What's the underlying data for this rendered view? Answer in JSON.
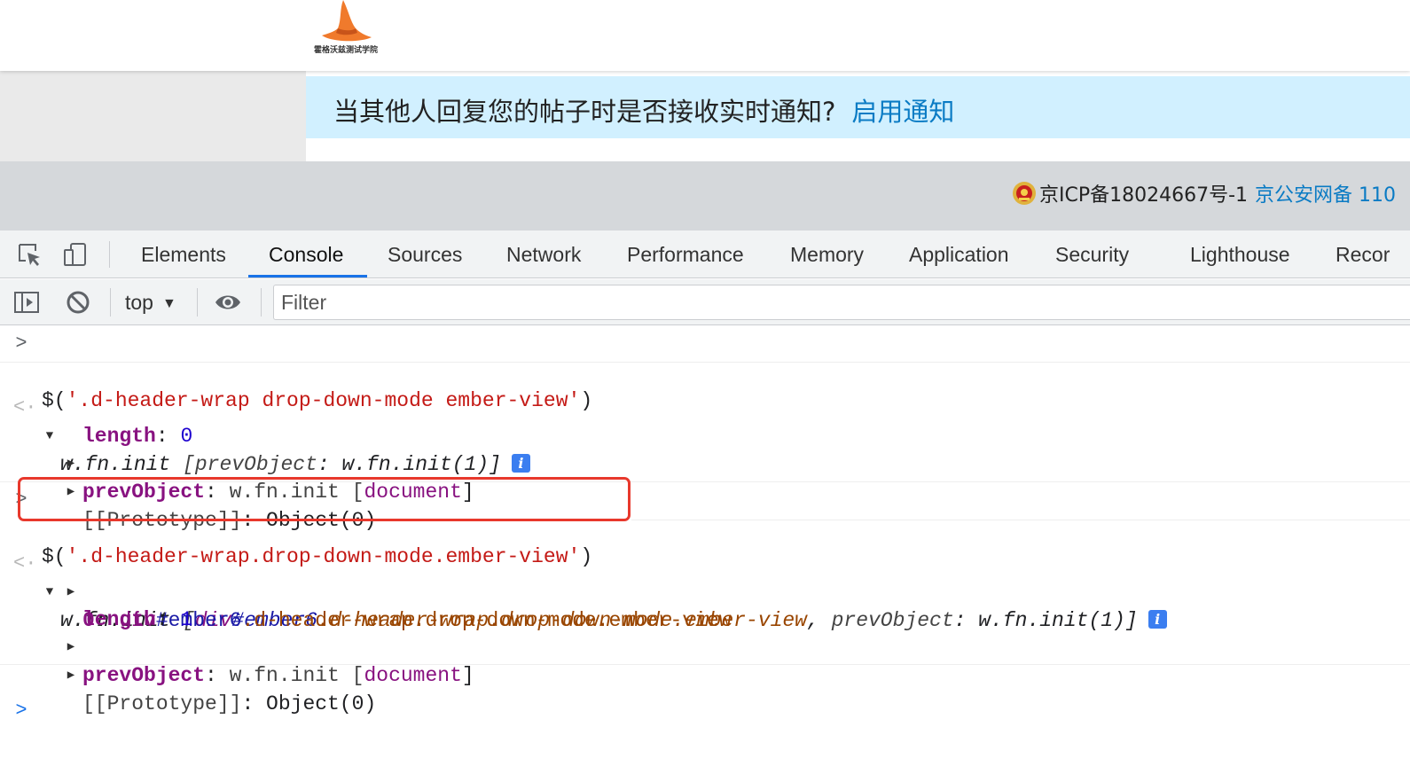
{
  "site": {
    "logo_text": "霍格沃兹测试学院",
    "notify_text": "当其他人回复您的帖子时是否接收实时通知?",
    "notify_link": "启用通知",
    "icp_text": "京ICP备18024667号-1",
    "police_link": "京公安网备 110"
  },
  "devtools": {
    "tabs": [
      {
        "label": "Elements"
      },
      {
        "label": "Console"
      },
      {
        "label": "Sources"
      },
      {
        "label": "Network"
      },
      {
        "label": "Performance"
      },
      {
        "label": "Memory"
      },
      {
        "label": "Application"
      },
      {
        "label": "Security"
      },
      {
        "label": "Lighthouse"
      },
      {
        "label": "Recor"
      }
    ],
    "active_tab": "Console",
    "accent_color": "#1a73e8",
    "toolbar": {
      "context": "top",
      "filter_placeholder": "Filter"
    },
    "console": {
      "cmd1": {
        "prefix": "$(",
        "arg": "'.d-header-wrap drop-down-mode ember-view'",
        "suffix": ")"
      },
      "res1": {
        "head_obj": "w.fn.init",
        "head_open": " [",
        "head_key": "prevObject",
        "head_colon": ": ",
        "head_val": "w.fn.init(1)",
        "head_close": "]",
        "length_key": "length",
        "length_val": "0",
        "prev_key": "prevObject",
        "prev_val_a": "w.fn.init [",
        "prev_val_doc": "document",
        "prev_val_b": "]",
        "proto_key": "[[Prototype]]",
        "proto_val": "Object(0)"
      },
      "cmd2": {
        "prefix": "$(",
        "arg": "'.d-header-wrap.drop-down-mode.ember-view'",
        "suffix": ")"
      },
      "res2": {
        "head_obj": "w.fn.init",
        "head_open": " [",
        "head_tag": "div",
        "head_id": "#ember6",
        "head_cls": ".d-header-wrap.drop-down-mode.ember-view",
        "head_comma": ", ",
        "head_key": "prevObject",
        "head_colon": ": ",
        "head_val": "w.fn.init(1)",
        "head_close": "]",
        "item_key": "0",
        "item_tag": "div",
        "item_id": "#ember6",
        "item_cls": ".d-header-wrap.drop-down-mode.ember-view",
        "length_key": "length",
        "length_val": "1",
        "prev_key": "prevObject",
        "prev_val_a": "w.fn.init [",
        "prev_val_doc": "document",
        "prev_val_b": "]",
        "proto_key": "[[Prototype]]",
        "proto_val": "Object(0)"
      },
      "highlight_color": "#e8382c"
    }
  }
}
